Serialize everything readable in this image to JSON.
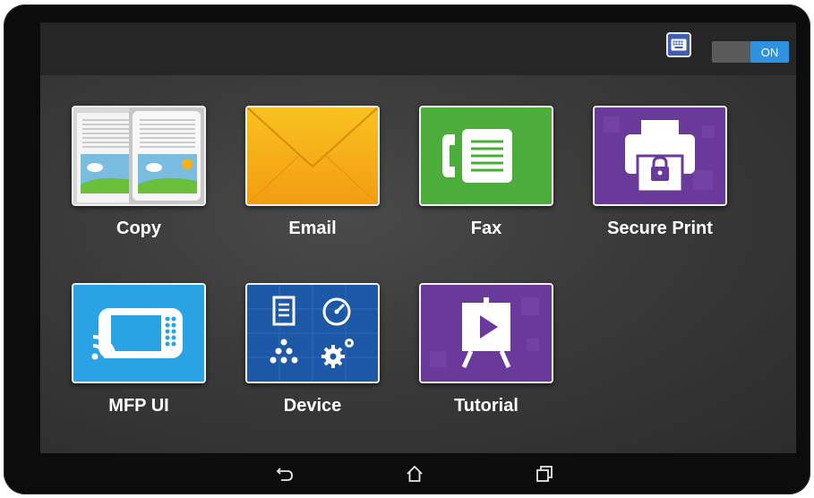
{
  "status_bar": {
    "keyboard_icon": "keyboard-icon",
    "toggle_state": "ON",
    "accent": "#2f92de"
  },
  "apps": [
    {
      "label": "Copy",
      "icon": "copy-icon"
    },
    {
      "label": "Email",
      "icon": "envelope-icon"
    },
    {
      "label": "Fax",
      "icon": "fax-icon"
    },
    {
      "label": "Secure Print",
      "icon": "secure-print-icon"
    },
    {
      "label": "MFP UI",
      "icon": "mfp-panel-icon"
    },
    {
      "label": "Device",
      "icon": "device-icon"
    },
    {
      "label": "Tutorial",
      "icon": "tutorial-icon"
    }
  ],
  "nav_bar": {
    "back": "back-icon",
    "home": "home-icon",
    "recents": "recents-icon"
  }
}
